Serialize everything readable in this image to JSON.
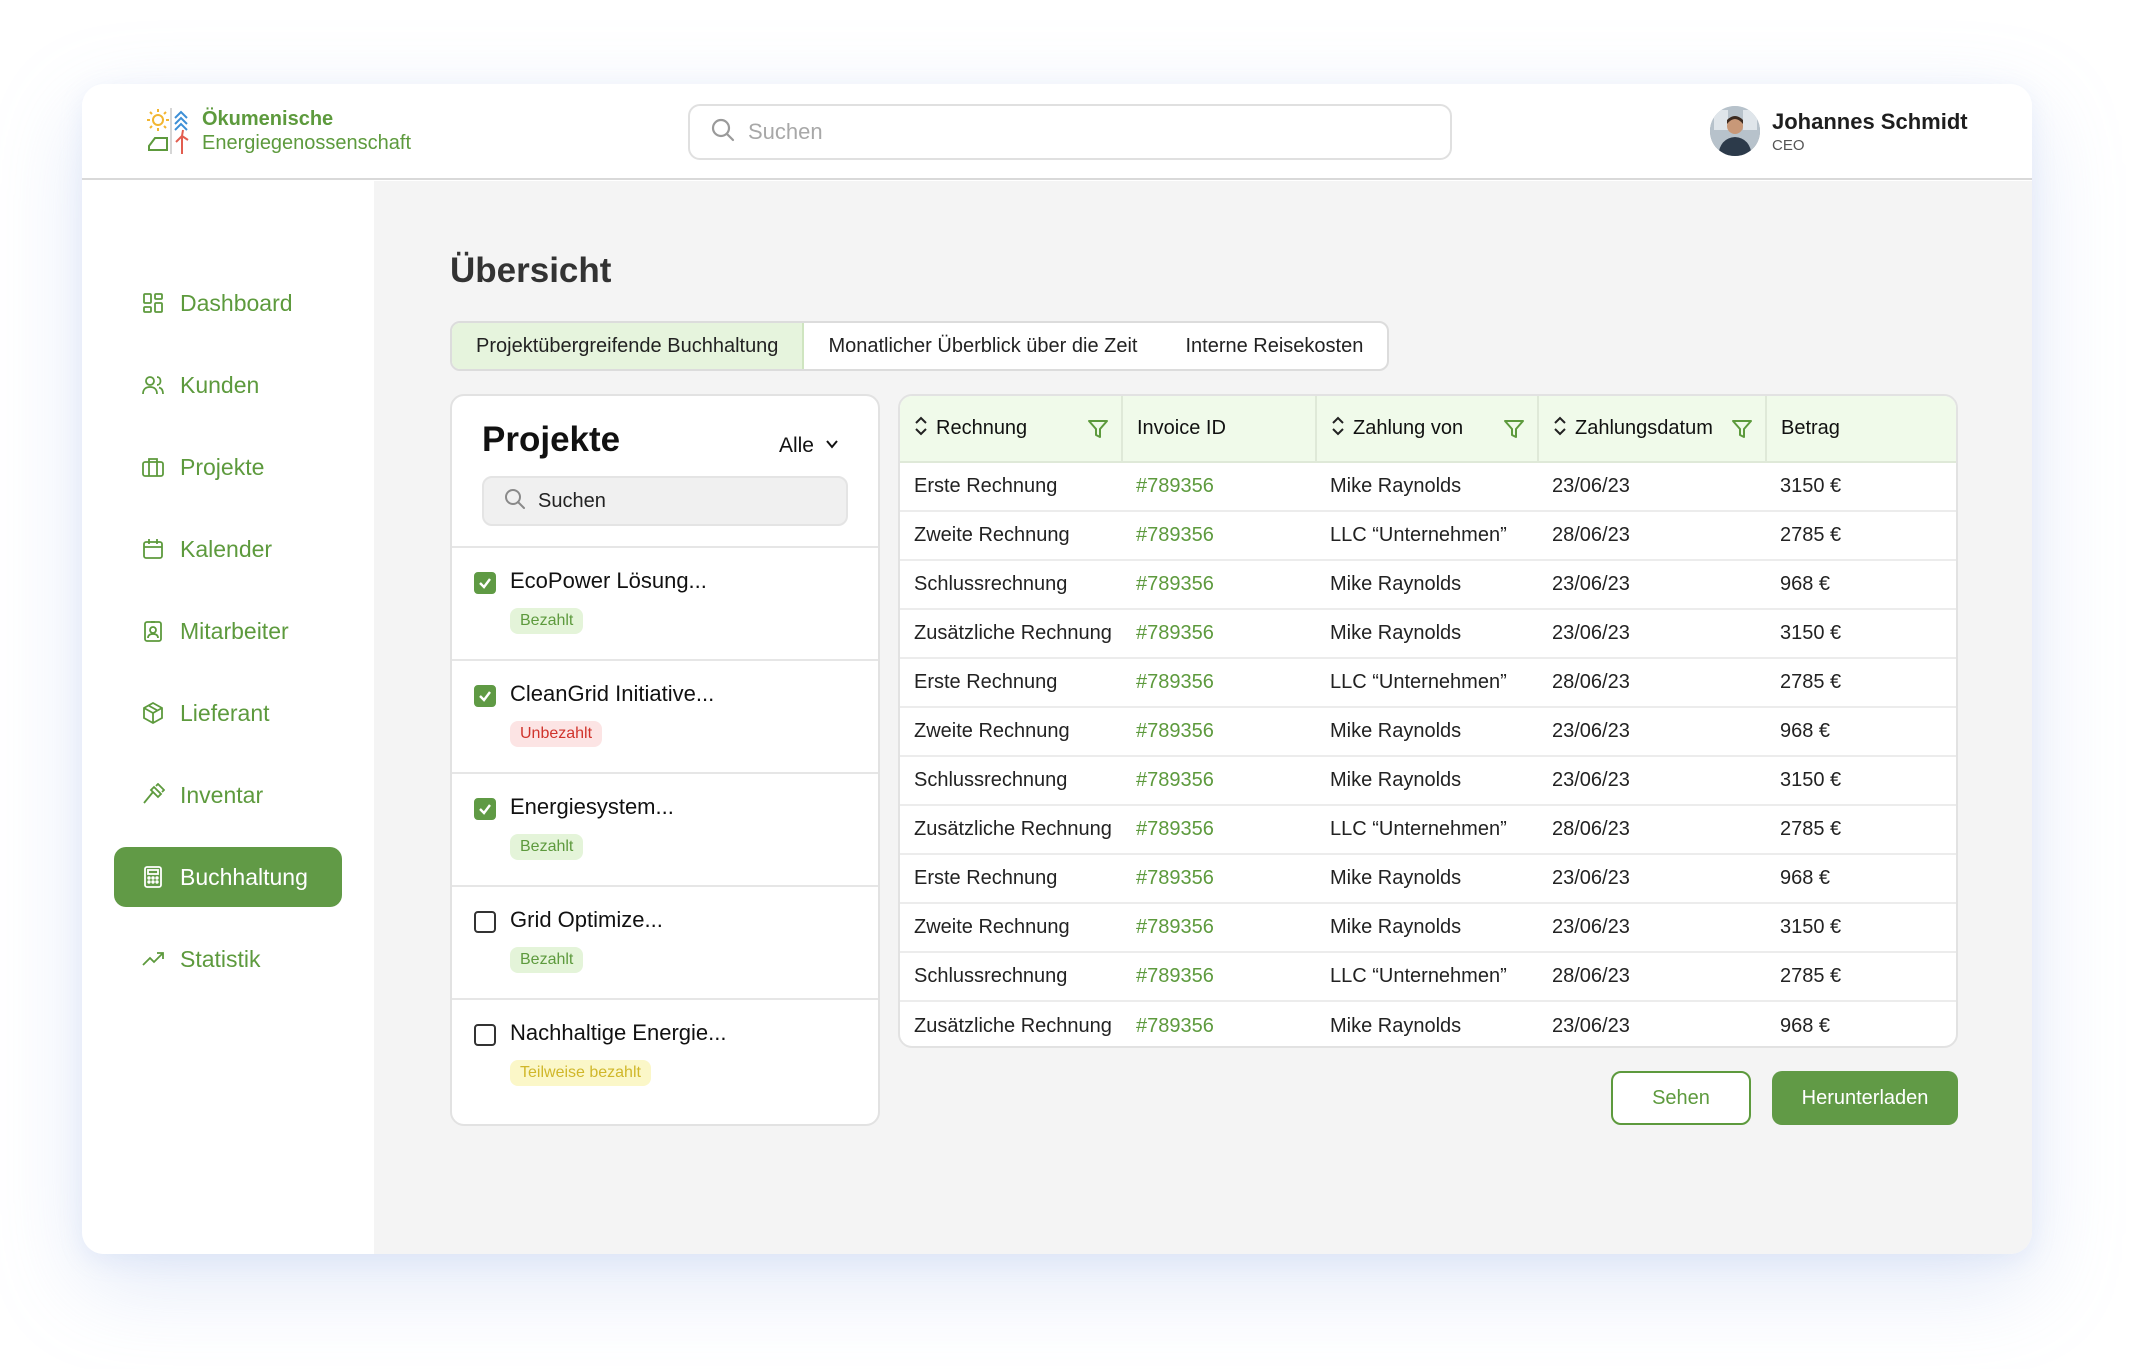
{
  "app": {
    "logo_line1": "Ökumenische",
    "logo_line2": "Energiegenossenschaft"
  },
  "header": {
    "search_placeholder": "Suchen",
    "user_name": "Johannes Schmidt",
    "user_role": "CEO"
  },
  "sidebar": {
    "items": [
      {
        "label": "Dashboard",
        "icon": "dashboard-icon"
      },
      {
        "label": "Kunden",
        "icon": "users-icon"
      },
      {
        "label": "Projekte",
        "icon": "briefcase-icon"
      },
      {
        "label": "Kalender",
        "icon": "calendar-icon"
      },
      {
        "label": "Mitarbeiter",
        "icon": "id-badge-icon"
      },
      {
        "label": "Lieferant",
        "icon": "package-icon"
      },
      {
        "label": "Inventar",
        "icon": "hammer-icon"
      },
      {
        "label": "Buchhaltung",
        "icon": "calculator-icon",
        "active": true
      },
      {
        "label": "Statistik",
        "icon": "trending-up-icon"
      }
    ]
  },
  "main": {
    "title": "Übersicht",
    "tabs": [
      {
        "label": "Projektübergreifende Buchhaltung",
        "active": true
      },
      {
        "label": "Monatlicher Überblick über die Zeit"
      },
      {
        "label": "Interne Reisekosten"
      }
    ]
  },
  "projects": {
    "title": "Projekte",
    "filter_label": "Alle",
    "search_placeholder": "Suchen",
    "items": [
      {
        "name": "EcoPower Lösung...",
        "checked": true,
        "status": "Bezahlt",
        "status_type": "paid"
      },
      {
        "name": "CleanGrid Initiative...",
        "checked": true,
        "status": "Unbezahlt",
        "status_type": "unpaid"
      },
      {
        "name": "Energiesystem...",
        "checked": true,
        "status": "Bezahlt",
        "status_type": "paid"
      },
      {
        "name": "Grid Optimize...",
        "checked": false,
        "status": "Bezahlt",
        "status_type": "paid"
      },
      {
        "name": "Nachhaltige Energie...",
        "checked": false,
        "status": "Teilweise bezahlt",
        "status_type": "partial"
      }
    ]
  },
  "table": {
    "columns": [
      "Rechnung",
      "Invoice ID",
      "Zahlung von",
      "Zahlungsdatum",
      "Betrag"
    ],
    "rows": [
      [
        "Erste Rechnung",
        "#789356",
        "Mike Raynolds",
        "23/06/23",
        "3150 €"
      ],
      [
        "Zweite Rechnung",
        "#789356",
        "LLC “Unternehmen”",
        "28/06/23",
        "2785 €"
      ],
      [
        "Schlussrechnung",
        "#789356",
        "Mike Raynolds",
        "23/06/23",
        "968 €"
      ],
      [
        "Zusätzliche Rechnung",
        "#789356",
        "Mike Raynolds",
        "23/06/23",
        "3150 €"
      ],
      [
        "Erste Rechnung",
        "#789356",
        "LLC “Unternehmen”",
        "28/06/23",
        "2785 €"
      ],
      [
        "Zweite Rechnung",
        "#789356",
        "Mike Raynolds",
        "23/06/23",
        "968 €"
      ],
      [
        "Schlussrechnung",
        "#789356",
        "Mike Raynolds",
        "23/06/23",
        "3150 €"
      ],
      [
        "Zusätzliche Rechnung",
        "#789356",
        "LLC “Unternehmen”",
        "28/06/23",
        "2785 €"
      ],
      [
        "Erste Rechnung",
        "#789356",
        "Mike Raynolds",
        "23/06/23",
        "968 €"
      ],
      [
        "Zweite Rechnung",
        "#789356",
        "Mike Raynolds",
        "23/06/23",
        "3150 €"
      ],
      [
        "Schlussrechnung",
        "#789356",
        "LLC “Unternehmen”",
        "28/06/23",
        "2785 €"
      ],
      [
        "Zusätzliche Rechnung",
        "#789356",
        "Mike Raynolds",
        "23/06/23",
        "968 €"
      ]
    ]
  },
  "actions": {
    "see_label": "Sehen",
    "download_label": "Herunterladen"
  },
  "colors": {
    "brand_green": "#619a46",
    "light_green": "#e6f4dd",
    "unpaid_red": "#d0342c",
    "partial_yellow": "#fbf7c8"
  }
}
